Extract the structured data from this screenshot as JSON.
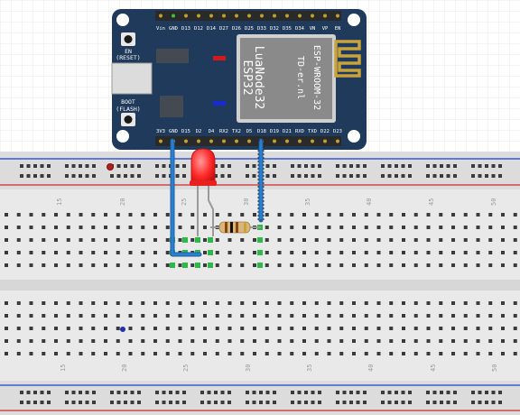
{
  "board": {
    "pins_top": [
      "Vin",
      "GND",
      "D13",
      "D12",
      "D14",
      "D27",
      "D26",
      "D25",
      "D33",
      "D32",
      "D35",
      "D34",
      "VN",
      "VP",
      "EN"
    ],
    "pins_bottom": [
      "3V3",
      "GND",
      "D15",
      "D2",
      "D4",
      "RX2",
      "TX2",
      "D5",
      "D18",
      "D19",
      "D21",
      "RXD",
      "TXD",
      "D22",
      "D23"
    ],
    "en_label": "EN",
    "reset_label": "(RESET)",
    "boot_label": "BOOT",
    "flash_label": "(FLASH)",
    "module_name": "ESP-WROOM-32",
    "module_site": "TD-er.nl",
    "board_name_1": "LuaNode32",
    "board_name_2": "ESP32"
  },
  "breadboard": {
    "column_numbers_top": [
      "15",
      "20",
      "25",
      "30",
      "35",
      "40",
      "45",
      "50"
    ],
    "column_numbers_bottom": [
      "15",
      "20",
      "25",
      "30",
      "35",
      "40",
      "45",
      "50"
    ]
  },
  "colors": {
    "board": "#1f3a5a",
    "wire": "#2b7fd0",
    "led": "#ff2a2a",
    "rail_red": "#d24a4a",
    "rail_blue": "#3a5bd0",
    "active_hole": "#2db84a"
  },
  "components": {
    "led": "red-led",
    "resistor": "resistor",
    "wire_gnd": "gnd-wire",
    "wire_d18": "d18-wire"
  }
}
